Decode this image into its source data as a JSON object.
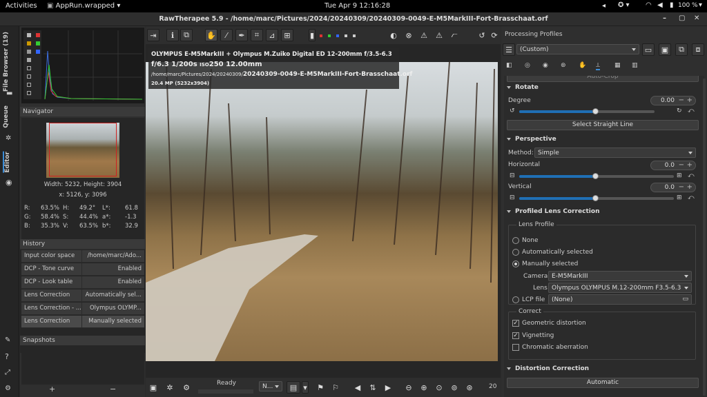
{
  "topbar": {
    "activities": "Activities",
    "app_menu": "AppRun.wrapped",
    "clock": "Tue Apr 9  12:16:28",
    "battery": "100 %"
  },
  "title": "RawTherapee 5.9 - /home/marc/Pictures/2024/20240309/20240309-0049-E-M5MarkIII-Fort-Brasschaat.orf",
  "vtabs": {
    "file_browser": "File Browser (19)",
    "queue": "Queue",
    "editor": "Editor"
  },
  "navigator": {
    "header": "Navigator",
    "size": "Width: 5232, Height: 3904",
    "coords": "x: 5126, y: 3096",
    "values": [
      [
        "R:",
        "63.5%",
        "H:",
        "49.2°",
        "L*:",
        "61.8"
      ],
      [
        "G:",
        "58.4%",
        "S:",
        "44.4%",
        "a*:",
        "-1.3"
      ],
      [
        "B:",
        "35.3%",
        "V:",
        "63.5%",
        "b*:",
        "32.9"
      ]
    ]
  },
  "history": {
    "header": "History",
    "rows": [
      [
        "Input color space",
        "/home/marc/Ado..."
      ],
      [
        "DCP - Tone curve",
        "Enabled"
      ],
      [
        "DCP - Look table",
        "Enabled"
      ],
      [
        "Lens Correction",
        "Automatically sel..."
      ],
      [
        "Lens Correction - ...",
        "Olympus OLYMP..."
      ],
      [
        "Lens Correction",
        "Manually selected"
      ]
    ]
  },
  "snapshots": {
    "header": "Snapshots",
    "add": "+",
    "remove": "−"
  },
  "image_info": {
    "line1": "OLYMPUS E-M5MarkIII + Olympus M.Zuiko Digital ED 12-200mm f/3.5-6.3",
    "aperture": "f/6.3",
    "shutter": "1/200s",
    "iso_label": "ISO",
    "iso": "250",
    "focal": "12.00mm",
    "path_dir": "/home/marc/Pictures/2024/20240309/",
    "path_file": "20240309-0049-E-M5MarkIII-Fort-Brasschaat.orf",
    "mp": "20.4 MP (5232x3904)"
  },
  "status": {
    "ready": "Ready",
    "zoom_text": "20",
    "dropdown": "N..."
  },
  "profiles": {
    "header": "Processing Profiles",
    "value": "(Custom)"
  },
  "rotate": {
    "title": "Rotate",
    "degree_label": "Degree",
    "degree_value": "0.00",
    "straight_button": "Select Straight Line",
    "partial_top": "Auto-Crop"
  },
  "perspective": {
    "title": "Perspective",
    "method_label": "Method:",
    "method_value": "Simple",
    "horizontal_label": "Horizontal",
    "horizontal_value": "0.0",
    "vertical_label": "Vertical",
    "vertical_value": "0.0"
  },
  "lens": {
    "title": "Profiled Lens Correction",
    "profile_group": "Lens Profile",
    "none": "None",
    "auto": "Automatically selected",
    "manual": "Manually selected",
    "camera_label": "Camera",
    "camera_value": "E-M5MarkIII",
    "lens_label": "Lens",
    "lens_value": "Olympus OLYMPUS M.12-200mm F3.5-6.3",
    "lcp_label": "LCP file",
    "lcp_value": "(None)",
    "correct_group": "Correct",
    "geometric": "Geometric distortion",
    "vignetting": "Vignetting",
    "chromatic": "Chromatic aberration"
  },
  "distortion": {
    "title": "Distortion Correction",
    "partial_button": "Automatic"
  },
  "sliders": {
    "degree": 0.5,
    "horizontal": 0.5,
    "vertical": 0.5
  }
}
